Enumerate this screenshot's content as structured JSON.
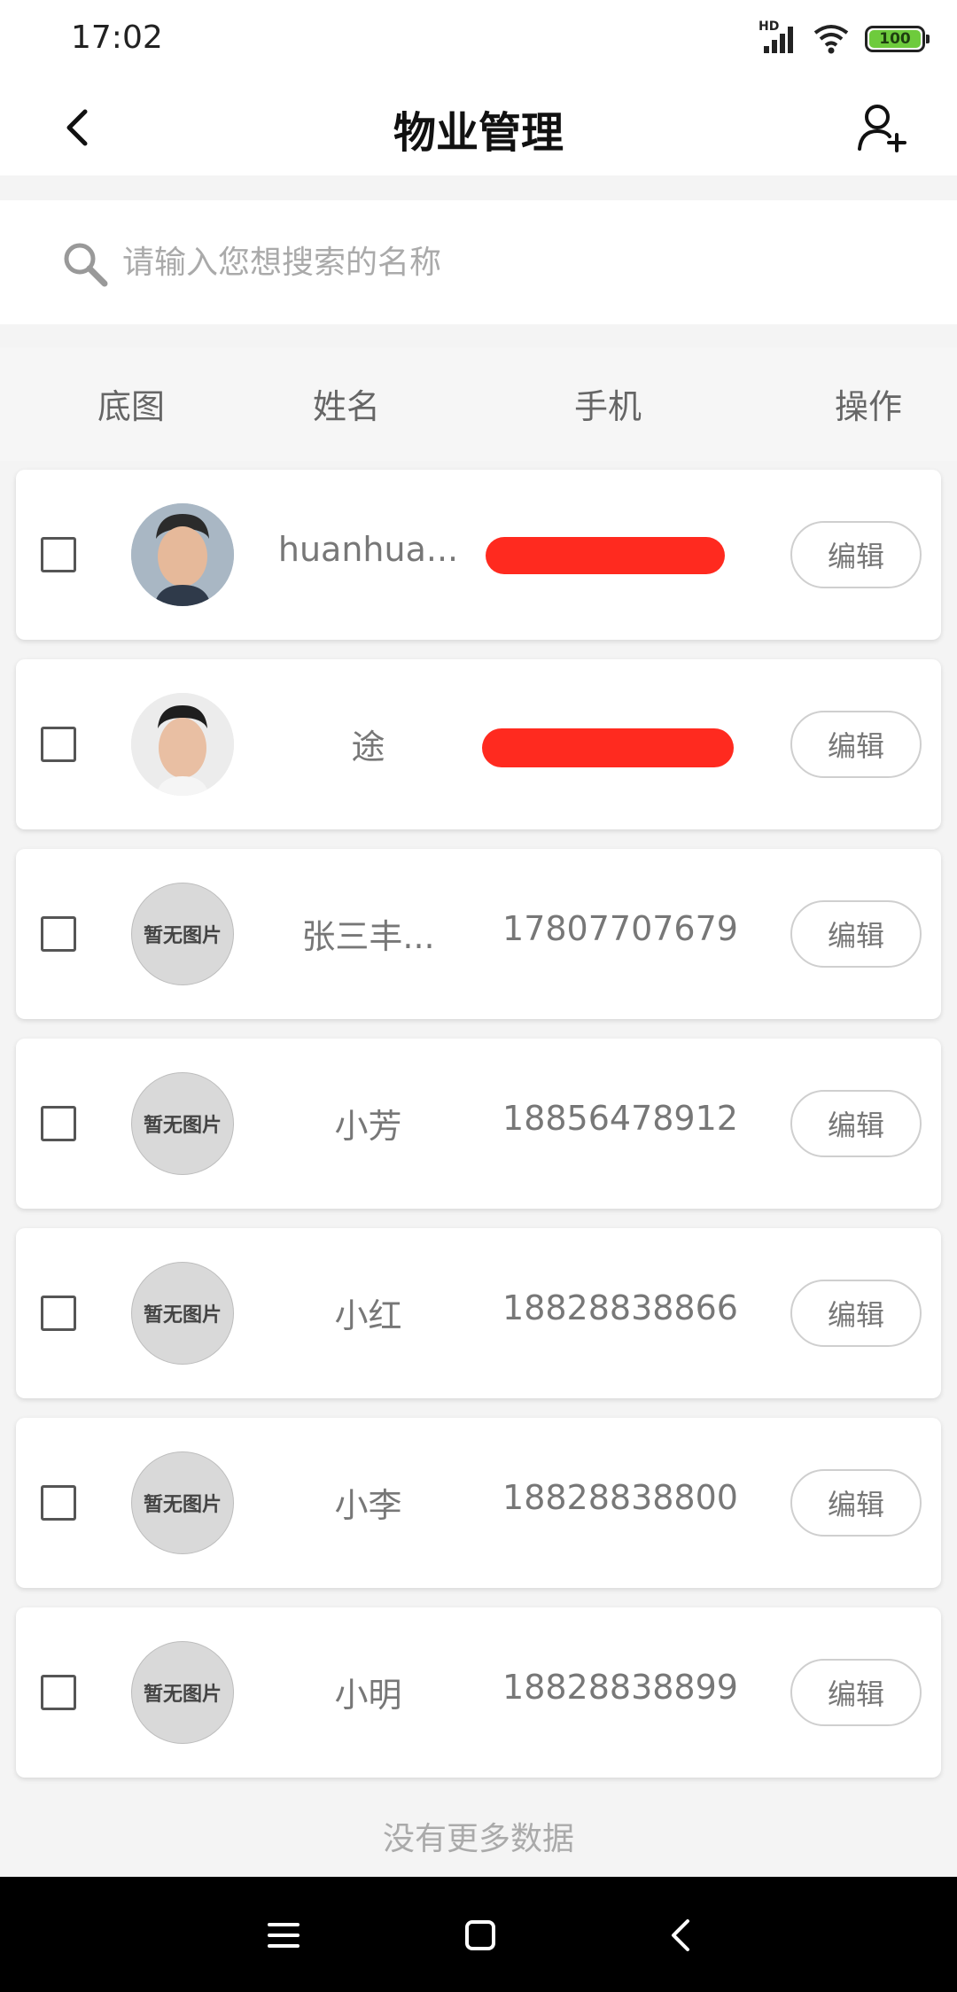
{
  "status_bar": {
    "time": "17:02",
    "network_label": "HD",
    "battery_level": "100"
  },
  "nav": {
    "title": "物业管理",
    "back_icon": "chevron-left-icon",
    "add_icon": "add-user-icon"
  },
  "search": {
    "placeholder": "请输入您想搜索的名称",
    "value": ""
  },
  "table": {
    "headers": [
      "底图",
      "姓名",
      "手机",
      "操作"
    ],
    "rows": [
      {
        "avatar": "photo",
        "avatar_label": "",
        "name": "huanhua...",
        "phone": "",
        "phone_redacted": true,
        "edit_label": "编辑"
      },
      {
        "avatar": "photo",
        "avatar_label": "",
        "name": "途",
        "phone": "",
        "phone_redacted": true,
        "edit_label": "编辑"
      },
      {
        "avatar": "placeholder",
        "avatar_label": "暂无图片",
        "name": "张三丰...",
        "phone": "17807707679",
        "phone_redacted": false,
        "edit_label": "编辑"
      },
      {
        "avatar": "placeholder",
        "avatar_label": "暂无图片",
        "name": "小芳",
        "phone": "18856478912",
        "phone_redacted": false,
        "edit_label": "编辑"
      },
      {
        "avatar": "placeholder",
        "avatar_label": "暂无图片",
        "name": "小红",
        "phone": "18828838866",
        "phone_redacted": false,
        "edit_label": "编辑"
      },
      {
        "avatar": "placeholder",
        "avatar_label": "暂无图片",
        "name": "小李",
        "phone": "18828838800",
        "phone_redacted": false,
        "edit_label": "编辑"
      },
      {
        "avatar": "placeholder",
        "avatar_label": "暂无图片",
        "name": "小明",
        "phone": "18828838899",
        "phone_redacted": false,
        "edit_label": "编辑"
      }
    ]
  },
  "footer": {
    "no_more": "没有更多数据"
  },
  "colors": {
    "redaction": "#ff2a1f",
    "battery": "#6ecb3c"
  }
}
